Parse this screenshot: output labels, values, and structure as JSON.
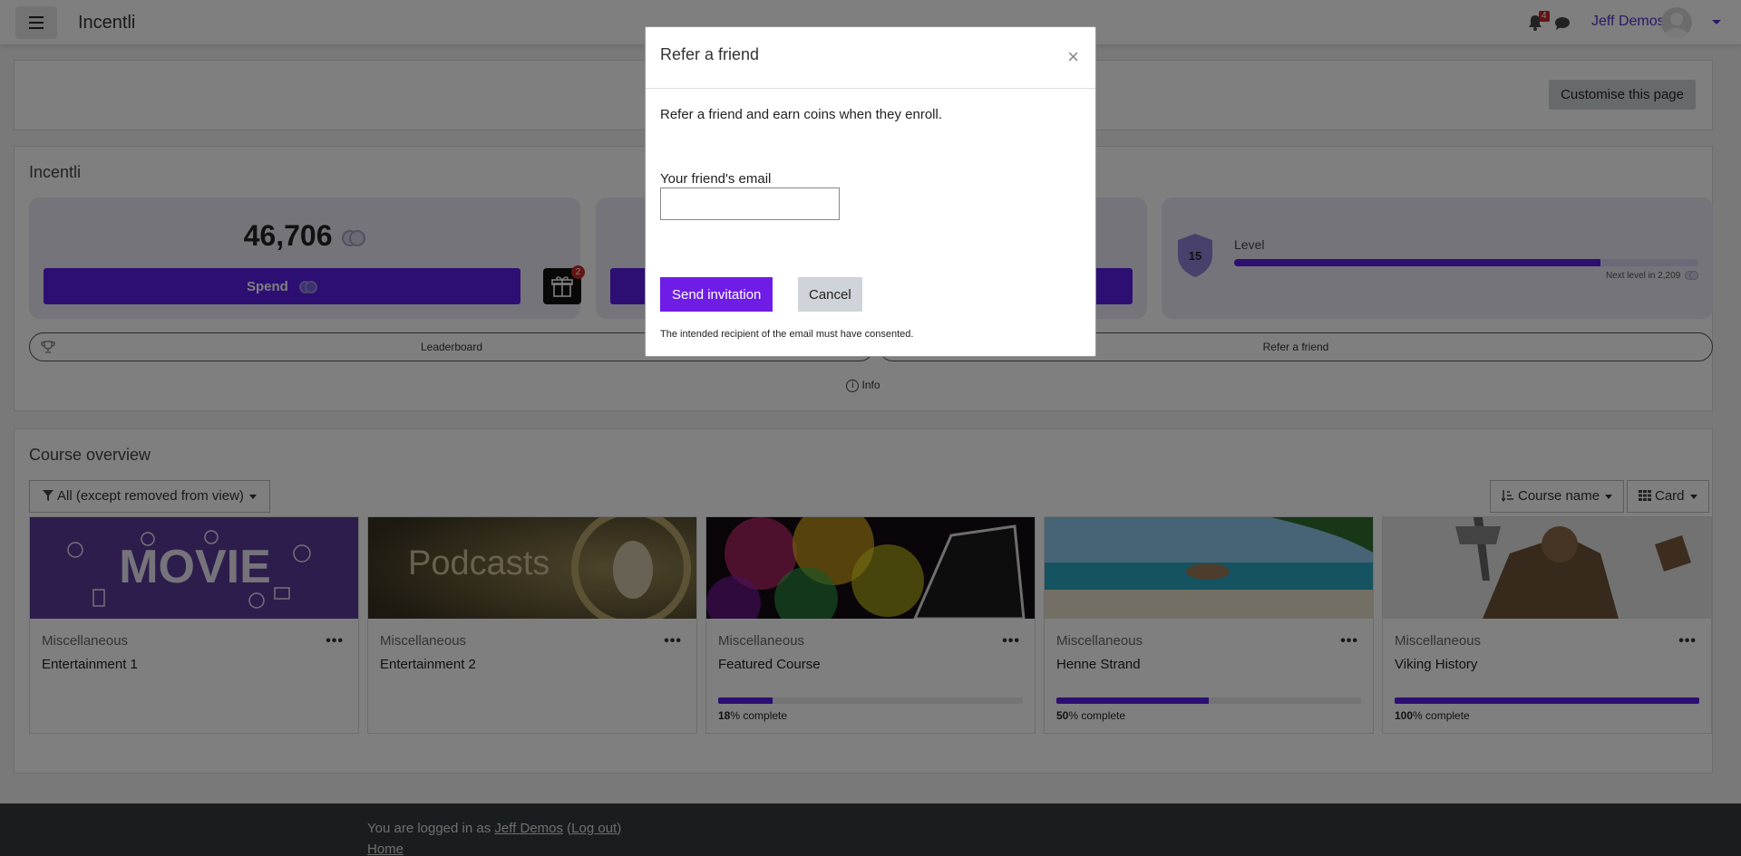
{
  "navbar": {
    "site_name": "Incentli",
    "notification_count": "4",
    "user_name": "Jeff Demos"
  },
  "topbar": {
    "customise_label": "Customise this page"
  },
  "incentli": {
    "title": "Incentli",
    "coins": "46,706",
    "spend_label": "Spend",
    "gift_count": "2",
    "level_label": "Level",
    "level_number": "15",
    "level_progress": 0.79,
    "next_level_text": "Next level in 2,209",
    "leaderboard_label": "Leaderboard",
    "refer_label": "Refer a friend",
    "info_label": "Info"
  },
  "course_overview": {
    "title": "Course overview",
    "filter_label": "All (except removed from view)",
    "sort_label": "Course name",
    "view_label": "Card",
    "courses": [
      {
        "category": "Miscellaneous",
        "name": "Entertainment 1",
        "image": "movie-banner",
        "progress": null
      },
      {
        "category": "Miscellaneous",
        "name": "Entertainment 2",
        "image": "podcasts-banner",
        "image_text": "Podcasts",
        "progress": null
      },
      {
        "category": "Miscellaneous",
        "name": "Featured Course",
        "image": "colorful-banner",
        "progress": 18,
        "progress_suffix": "% complete"
      },
      {
        "category": "Miscellaneous",
        "name": "Henne Strand",
        "image": "beach-banner",
        "progress": 50,
        "progress_suffix": "% complete"
      },
      {
        "category": "Miscellaneous",
        "name": "Viking History",
        "image": "viking-banner",
        "progress": 100,
        "progress_suffix": "% complete"
      }
    ]
  },
  "footer": {
    "logged_in_prefix": "You are logged in as",
    "user_link": "Jeff Demos",
    "logout_link": "Log out",
    "home_link": "Home"
  },
  "modal": {
    "title": "Refer a friend",
    "intro": "Refer a friend and earn coins when they enroll.",
    "email_label": "Your friend's email",
    "email_value": "",
    "send_label": "Send invitation",
    "cancel_label": "Cancel",
    "consent_text": "The intended recipient of the email must have consented."
  },
  "colors": {
    "accent": "#5b1ee6",
    "send_button": "#6f1de6",
    "footer_bg": "#343a40"
  }
}
